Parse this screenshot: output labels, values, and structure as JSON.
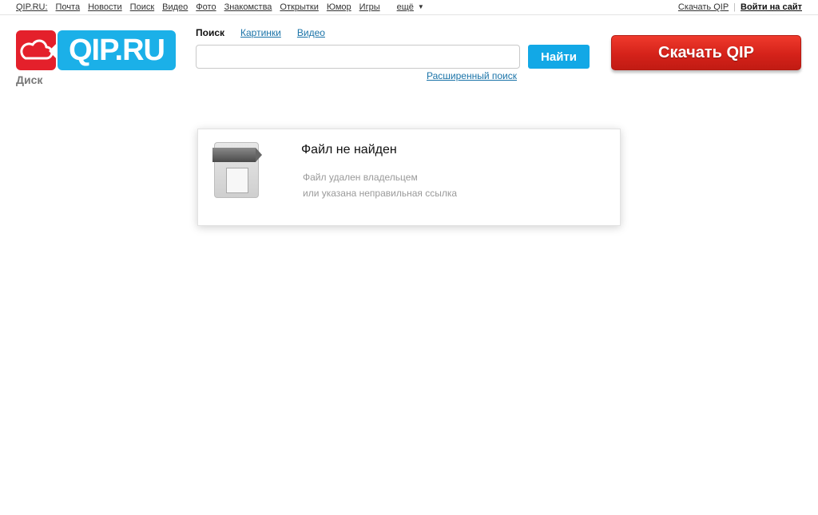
{
  "topnav": {
    "items": [
      "QIP.RU:",
      "Почта",
      "Новости",
      "Поиск",
      "Видео",
      "Фото",
      "Знакомства",
      "Открытки",
      "Юмор",
      "Игры"
    ],
    "more_label": "ещё",
    "more_icon": "triangle-down-icon",
    "download_link": "Скачать QIP",
    "login_link": "Войти на сайт"
  },
  "logo": {
    "text": "QIP.RU",
    "cloud_icon": "cloud-icon",
    "colors": {
      "red": "#e4202b",
      "blue": "#1bb0e8"
    }
  },
  "section_name": "Диск",
  "search": {
    "tabs": [
      "Поиск",
      "Картинки",
      "Видео"
    ],
    "active_tab": "Поиск",
    "input_value": "",
    "button_label": "Найти",
    "advanced_link": "Расширенный поиск"
  },
  "download_button": {
    "label": "Скачать QIP",
    "color": "#d5221a"
  },
  "error_card": {
    "title": "Файл не найден",
    "line1": "Файл удален владельцем",
    "line2": "или указана неправильная ссылка",
    "icon": "missing-file-icon"
  }
}
